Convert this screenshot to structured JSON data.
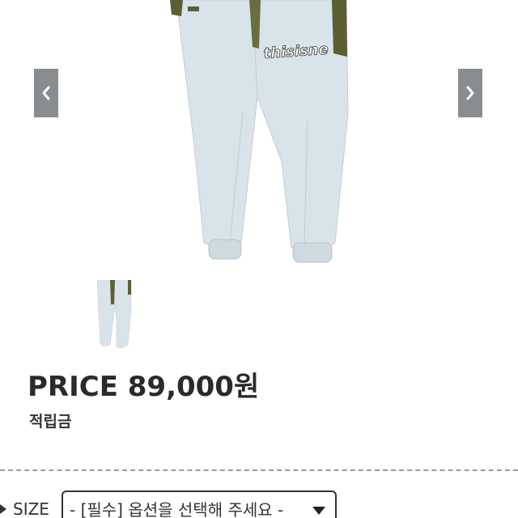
{
  "product": {
    "brand_print": "thisisne",
    "price_text": "PRICE 89,000원",
    "points_label": "적립금"
  },
  "gallery": {
    "prev_icon": "chevron-left-icon",
    "next_icon": "chevron-right-icon"
  },
  "options": {
    "size_label": "SIZE",
    "size_marker_icon": "triangle-right-icon",
    "size_select_value": "- [필수] 옵션을 선택해 주세요 -",
    "select_caret_icon": "caret-down-icon"
  },
  "colors": {
    "pants": "#d9e4ea",
    "stripe": "#5b5f33",
    "arrow_bg": "#8a8d90"
  }
}
